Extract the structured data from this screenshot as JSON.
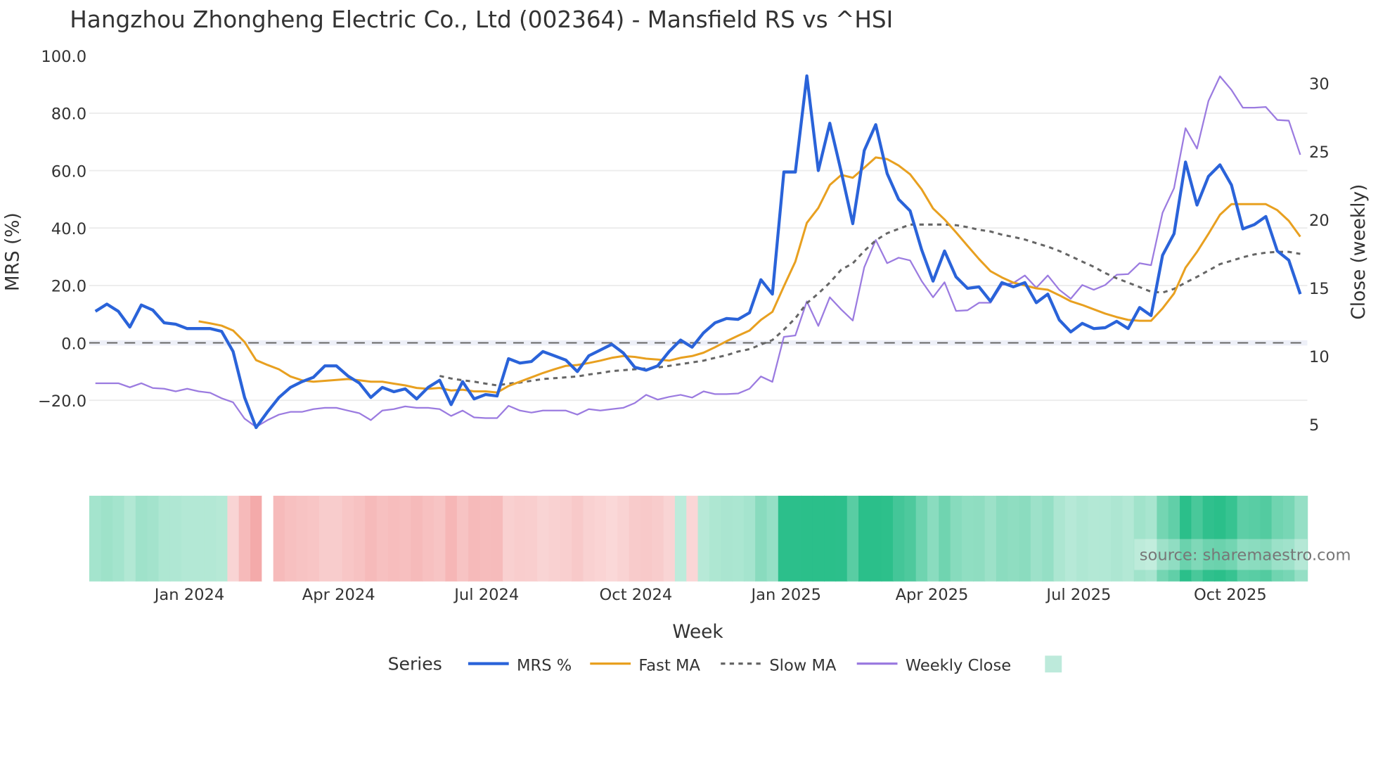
{
  "chart_data": {
    "type": "line",
    "title": "Hangzhou Zhongheng Electric Co., Ltd (002364) - Mansfield RS vs ^HSI",
    "xlabel": "Week",
    "ylabel": "MRS (%)",
    "y2label": "Close (weekly)",
    "ylim": [
      -32,
      100
    ],
    "y2lim": [
      4.5,
      31
    ],
    "yticks": [
      100,
      80,
      60,
      40,
      20,
      0,
      -20
    ],
    "ytick_labels": [
      "100.0",
      "80.0",
      "60.0",
      "40.0",
      "20.0",
      "0.0",
      "−20.0"
    ],
    "y2ticks": [
      30,
      25,
      20,
      15,
      10,
      5
    ],
    "y2tick_labels": [
      "30",
      "25",
      "20",
      "15",
      "10",
      "5"
    ],
    "xticks": [
      {
        "label": "Jan 2024",
        "week": 8.2
      },
      {
        "label": "Apr 2024",
        "week": 21.2
      },
      {
        "label": "Jul 2024",
        "week": 34.1
      },
      {
        "label": "Oct 2024",
        "week": 47.1
      },
      {
        "label": "Jan 2025",
        "week": 60.2
      },
      {
        "label": "Apr 2025",
        "week": 72.9
      },
      {
        "label": "Jul 2025",
        "week": 85.7
      },
      {
        "label": "Oct 2025",
        "week": 98.9
      }
    ],
    "grid": true,
    "legend": {
      "title": "Series",
      "placement": "bottom-center"
    },
    "series": [
      {
        "name": "MRS %",
        "color": "#2a63d9",
        "axis": "left",
        "style": "solid",
        "values": [
          11,
          13.5,
          11,
          5.5,
          13.2,
          11.4,
          7,
          6.5,
          5,
          5,
          5,
          4,
          -3,
          -19,
          -29.5,
          -24,
          -19,
          -15.5,
          -13.5,
          -12,
          -8,
          -8,
          -11.5,
          -14,
          -19,
          -15.5,
          -17,
          -16,
          -19.5,
          -15.5,
          -13,
          -21.5,
          -13.5,
          -19.5,
          -18,
          -18.5,
          -5.5,
          -7,
          -6.5,
          -3,
          -4.5,
          -6,
          -10,
          -4.5,
          -2.5,
          -0.5,
          -3.5,
          -8.5,
          -9.5,
          -8,
          -3,
          1,
          -1.5,
          3.5,
          7,
          8.5,
          8.2,
          10.5,
          22,
          17,
          59.5,
          59.5,
          93,
          60,
          76.5,
          59.5,
          41.5,
          67,
          76,
          59,
          50,
          46,
          32.5,
          21.5,
          32,
          23,
          19,
          19.5,
          14.5,
          21,
          19.5,
          21,
          14,
          17,
          8,
          3.8,
          6.8,
          5,
          5.3,
          7.5,
          5,
          12.3,
          9.5,
          30.5,
          38,
          63,
          48,
          58,
          62,
          55,
          39.7,
          41.2,
          44,
          32,
          28.8,
          17
        ]
      },
      {
        "name": "Fast MA",
        "color": "#e8a020",
        "axis": "left",
        "style": "solid",
        "values": [
          7.5,
          6.8,
          6,
          4.3,
          0.3,
          -6,
          -7.7,
          -9.2,
          -11.7,
          -13,
          -13.5,
          -13.2,
          -12.9,
          -12.6,
          -13,
          -13.5,
          -13.5,
          -14.2,
          -14.8,
          -15.7,
          -16,
          -15.7,
          -16.6,
          -16.3,
          -16.9,
          -16.9,
          -17.3,
          -15,
          -13.5,
          -12,
          -10.5,
          -9.2,
          -8,
          -7.7,
          -7,
          -6.2,
          -5.2,
          -4.6,
          -4.9,
          -5.5,
          -5.8,
          -6.2,
          -5.2,
          -4.6,
          -3.4,
          -1.5,
          0.6,
          2.5,
          4.3,
          8,
          10.8,
          19.7,
          28.3,
          41.8,
          47,
          55,
          58.5,
          57.5,
          61,
          64.6,
          64,
          61.8,
          58.7,
          53.5,
          46.8,
          43,
          38.5,
          33.8,
          29.2,
          25,
          22.8,
          21,
          20,
          19,
          18.5,
          16.6,
          14.5,
          13.2,
          11.7,
          10.2,
          9,
          8,
          7.7,
          7.7,
          12,
          17.2,
          26.2,
          31.7,
          38,
          44.6,
          48.3,
          48.3,
          48.3,
          48.3,
          46.2,
          42.5,
          37
        ]
      },
      {
        "name": "Slow MA",
        "color": "#666666",
        "axis": "left",
        "style": "dotted",
        "values": [
          -11.5,
          -12.4,
          -13,
          -13.5,
          -14.2,
          -14.8,
          -14.2,
          -13.8,
          -13.2,
          -12.6,
          -12.3,
          -12,
          -11.7,
          -11,
          -10.5,
          -9.8,
          -9.5,
          -9.2,
          -8.9,
          -8.6,
          -8,
          -7.4,
          -6.8,
          -6.2,
          -5.2,
          -4.3,
          -3,
          -2.2,
          -0.6,
          1,
          4.6,
          8.6,
          13.8,
          17.2,
          21,
          25.5,
          27.7,
          32,
          35.7,
          38.2,
          39.7,
          41.2,
          41.2,
          41.2,
          41.2,
          41,
          40.3,
          39.4,
          38.8,
          37.7,
          36.9,
          36,
          34.7,
          33.5,
          32,
          30.2,
          28.3,
          26.5,
          24.3,
          22.5,
          21,
          19.4,
          17.8,
          17.5,
          18.8,
          21,
          23,
          25.2,
          27.4,
          28.6,
          29.8,
          30.8,
          31.4,
          31.7,
          31.7,
          31
        ]
      },
      {
        "name": "Weekly Close",
        "color": "#9b7be0",
        "axis": "right",
        "style": "solid",
        "values": [
          8,
          8,
          8,
          7.7,
          8,
          7.65,
          7.6,
          7.4,
          7.6,
          7.4,
          7.3,
          6.9,
          6.6,
          5.4,
          4.8,
          5.3,
          5.7,
          5.9,
          5.9,
          6.1,
          6.2,
          6.2,
          6,
          5.8,
          5.3,
          6,
          6.1,
          6.3,
          6.2,
          6.2,
          6.1,
          5.6,
          6,
          5.5,
          5.45,
          5.45,
          6.35,
          6,
          5.85,
          6,
          6,
          6,
          5.7,
          6.1,
          6,
          6.1,
          6.2,
          6.55,
          7.15,
          6.8,
          7,
          7.15,
          6.95,
          7.4,
          7.2,
          7.2,
          7.25,
          7.6,
          8.5,
          8.1,
          11.4,
          11.5,
          14,
          12.2,
          14.3,
          13.4,
          12.6,
          16.5,
          18.5,
          16.8,
          17.2,
          17,
          15.5,
          14.3,
          15.4,
          13.3,
          13.35,
          13.9,
          13.9,
          15.2,
          15.35,
          15.9,
          15,
          15.9,
          14.85,
          14.2,
          15.2,
          14.85,
          15.2,
          15.95,
          16,
          16.8,
          16.65,
          20.5,
          22.3,
          26.7,
          25.2,
          28.7,
          30.5,
          29.5,
          28.2,
          28.2,
          28.25,
          27.3,
          27.25,
          24.75
        ]
      }
    ],
    "heatmap": {
      "legend_color": "#bdeadb",
      "positive_color": "#2bbf8a",
      "negative_color": "#f4a9a9",
      "blank_weeks": [
        15
      ]
    },
    "watermark": "source: sharemaestro.com"
  }
}
